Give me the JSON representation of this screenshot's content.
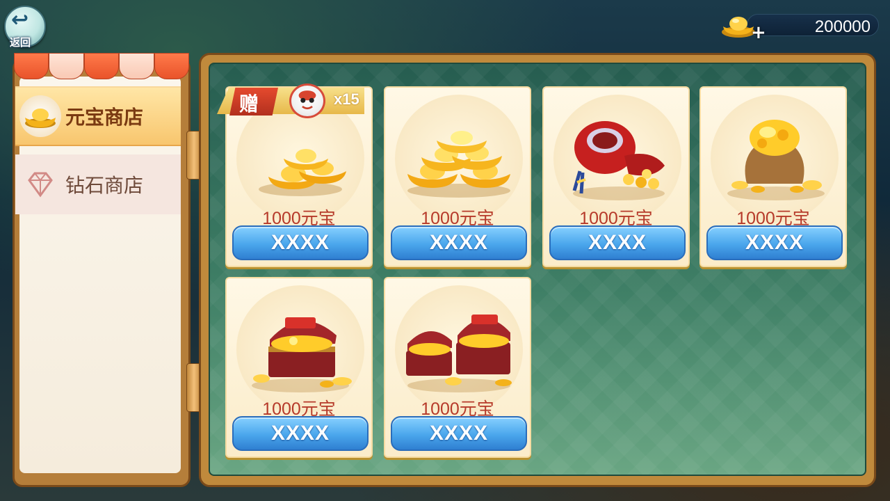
{
  "topbar": {
    "back_label": "返回",
    "currency_value": "200000",
    "add_label": "+"
  },
  "sidebar": {
    "items": [
      {
        "label": "元宝商店",
        "icon": "gold-ingot-icon",
        "active": true
      },
      {
        "label": "钻石商店",
        "icon": "diamond-icon",
        "active": false
      }
    ]
  },
  "badge": {
    "gift_label": "赠",
    "multiplier": "x15"
  },
  "products": [
    {
      "price": "1000元宝",
      "button": "XXXX",
      "art": "small-ingot-pile"
    },
    {
      "price": "1000元宝",
      "button": "XXXX",
      "art": "large-ingot-pile"
    },
    {
      "price": "1000元宝",
      "button": "XXXX",
      "art": "red-pouch"
    },
    {
      "price": "1000元宝",
      "button": "XXXX",
      "art": "gold-sack"
    },
    {
      "price": "1000元宝",
      "button": "XXXX",
      "art": "treasure-chest"
    },
    {
      "price": "1000元宝",
      "button": "XXXX",
      "art": "double-treasure-chest"
    }
  ]
}
